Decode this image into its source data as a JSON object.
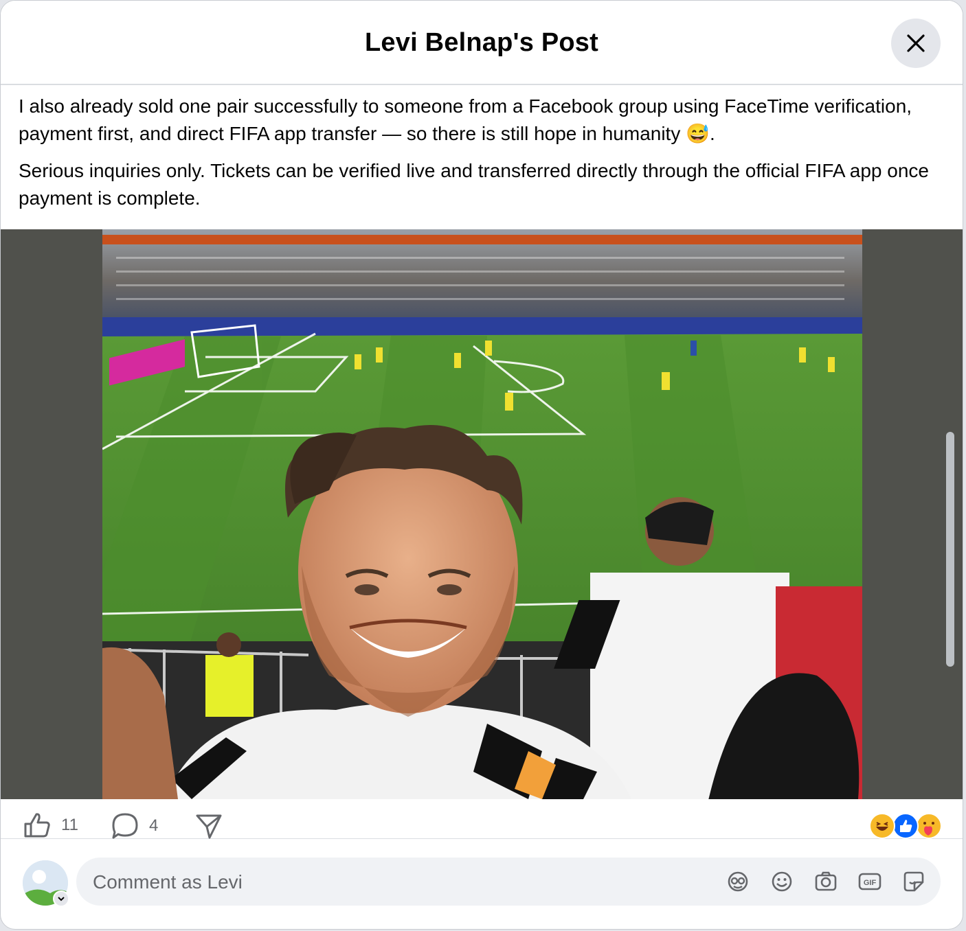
{
  "header": {
    "title": "Levi Belnap's Post"
  },
  "post": {
    "paragraphs": [
      "I also already sold one pair successfully to someone from a Facebook group using FaceTime verification, payment first, and direct FIFA app transfer — so there is still hope in humanity 😅.",
      "Serious inquiries only. Tickets can be verified live and transferred directly through the official FIFA app once payment is complete."
    ]
  },
  "photo": {
    "icon": "stadium-selfie-photo"
  },
  "actions": {
    "like_count": "11",
    "comment_count": "4"
  },
  "reactions": [
    "haha",
    "like",
    "care"
  ],
  "composer": {
    "placeholder": "Comment as Levi"
  },
  "colors": {
    "link_blue": "#0866ff",
    "secondary_text": "#65676b",
    "field_green": "#4e8a2e",
    "photo_bg": "#50514c"
  }
}
